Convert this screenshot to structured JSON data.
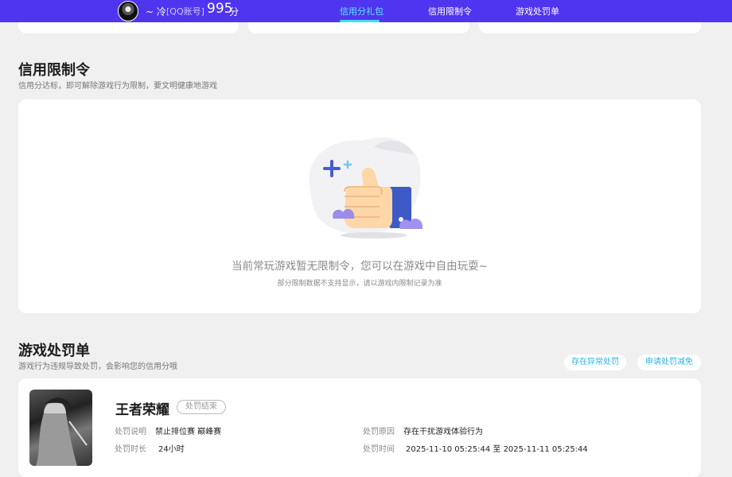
{
  "header": {
    "nickname": "~ 冷",
    "account_type": "[QQ账号]",
    "score": "995",
    "score_unit": "分",
    "nav": [
      {
        "label": "信用分礼包",
        "active": true
      },
      {
        "label": "信用限制令",
        "active": false
      },
      {
        "label": "游戏处罚单",
        "active": false
      }
    ]
  },
  "restriction": {
    "title": "信用限制令",
    "subtitle": "信用分达标，即可解除游戏行为限制，要文明健康地游戏",
    "empty_message": "当前常玩游戏暂无限制令，您可以在游戏中自由玩耍~",
    "empty_note": "部分限制数据不支持显示，请以游戏内限制记录为准"
  },
  "penalty": {
    "title": "游戏处罚单",
    "subtitle": "游戏行为违规导致处罚，会影响您的信用分哦",
    "actions": [
      "存在异常处罚",
      "申请处罚减免"
    ],
    "records": [
      {
        "game": "王者荣耀",
        "status": "处罚结束",
        "desc_label": "处罚说明",
        "desc_value": "禁止排位赛 巅峰赛",
        "duration_label": "处罚时长",
        "duration_value": "24小时",
        "reason_label": "处罚原因",
        "reason_value": "存在干扰游戏体验行为",
        "time_label": "处罚时间",
        "time_value": "2025-11-10 05:25:44 至 2025-11-11 05:25:44"
      }
    ]
  },
  "colors": {
    "header_bg": "#4f35f0",
    "active_tab": "#62e6ff",
    "link": "#28b4e6",
    "thumb_blue": "#3d5ac7"
  }
}
